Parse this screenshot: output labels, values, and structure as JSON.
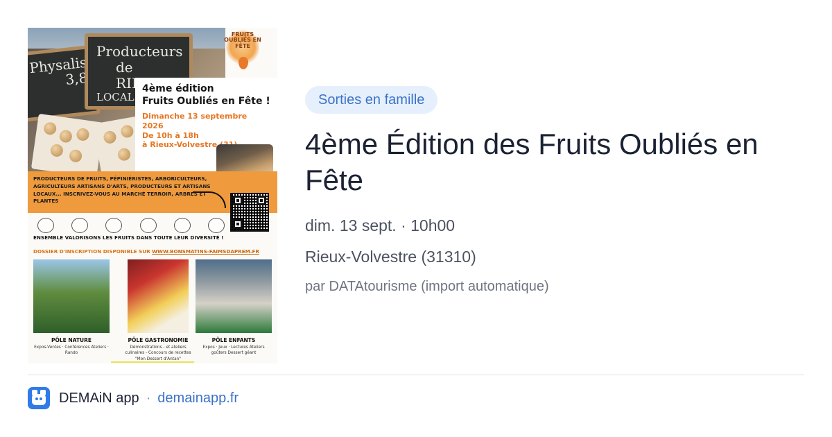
{
  "poster": {
    "chalk_left": "Physalis",
    "chalk_left_price": "3,8",
    "chalk_right_line1": "Producteurs",
    "chalk_right_line2": "de RIEUX",
    "chalk_right_line3": "LOCAL",
    "logo_text": "FRUITS OUBLIÉS EN FÊTE",
    "headline_line1": "4ème édition",
    "headline_line2": "Fruits Oubliés en Fête !",
    "headline_date": "Dimanche 13 septembre 2026",
    "headline_time": "De 10h à 18h",
    "headline_place": "à Rieux-Volvestre (31)",
    "band_text": "PRODUCTEURS DE FRUITS, PÉPINIÉRISTES, ARBORICULTEURS, AGRICULTEURS ARTISANS D'ARTS, PRODUCTEURS ET ARTISANS LOCAUX... INSCRIVEZ-VOUS AU MARCHÉ TERROIR, ARBRES ET PLANTES",
    "tagline": "ENSEMBLE VALORISONS LES FRUITS DANS TOUTE LEUR DIVERSITÉ !",
    "dossier_prefix": "DOSSIER D'INSCRIPTION DISPONIBLE SUR ",
    "dossier_url": "WWW.BONSMATINS-FAIMSDAPREM.FR",
    "poles": [
      {
        "name": "PÔLE NATURE",
        "desc": "Expos-Ventes · Conférences Ateliers · Rando"
      },
      {
        "name": "PÔLE GASTRONOMIE",
        "desc": "Démonstrations - et ateliers culinaires - Concours de recettes \"Mon Dessert d'Antan\""
      },
      {
        "name": "PÔLE ENFANTS",
        "desc": "Expos · Jeux · Lectures Ateliers goûters Dessert géant"
      }
    ]
  },
  "event": {
    "category": "Sorties en famille",
    "title": "4ème Édition des Fruits Oubliés en Fête",
    "datetime": "dim. 13 sept. · 10h00",
    "location": "Rieux-Volvestre (31310)",
    "source": "par DATAtourisme (import automatique)"
  },
  "footer": {
    "app_name": "DEMAiN app",
    "separator": "·",
    "domain": "demainapp.fr"
  },
  "colors": {
    "accent": "#3b72c9",
    "pill_bg": "#e6f0fc",
    "poster_orange": "#ef9a3d",
    "divider": "#d8e3ea"
  }
}
